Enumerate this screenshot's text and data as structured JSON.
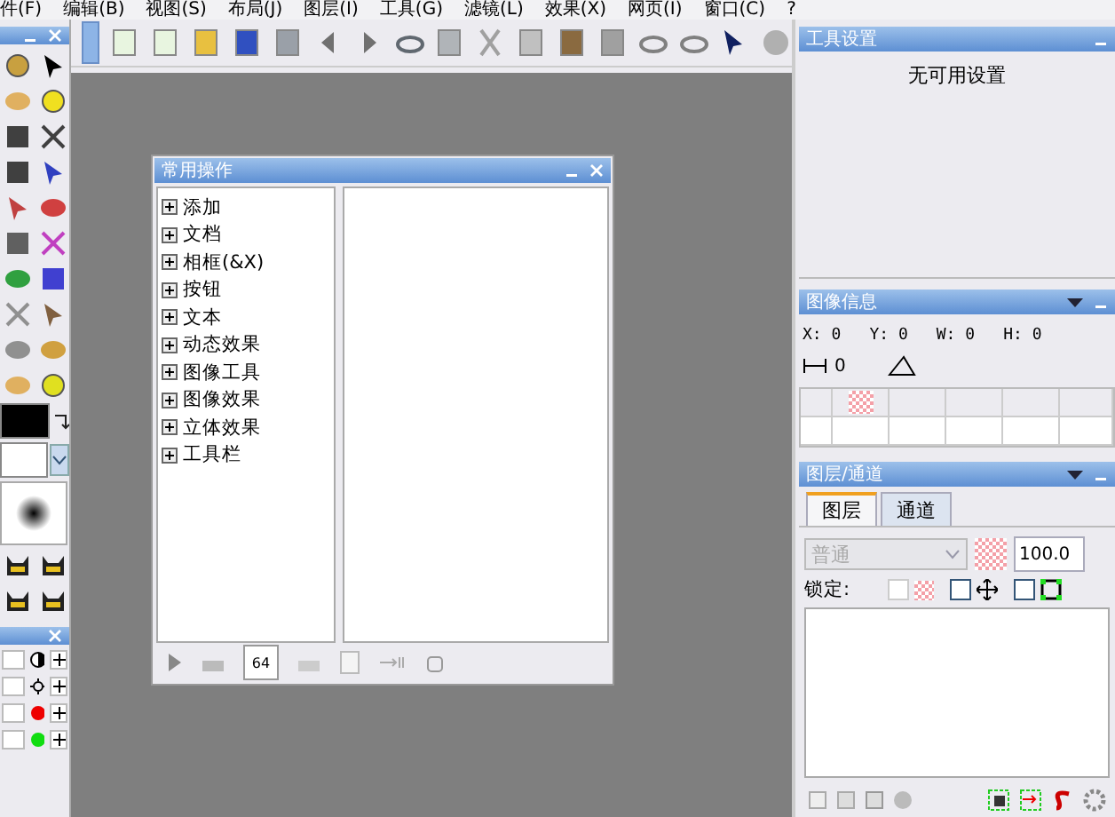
{
  "menu_bar": [
    {
      "label": "件(F)"
    },
    {
      "label": "编辑(B)"
    },
    {
      "label": "视图(S)"
    },
    {
      "label": "布局(J)"
    },
    {
      "label": "图层(I)"
    },
    {
      "label": "工具(G)"
    },
    {
      "label": "滤镜(L)"
    },
    {
      "label": "效果(X)"
    },
    {
      "label": "网页(I)"
    },
    {
      "label": "窗口(C)"
    },
    {
      "label": "?"
    }
  ],
  "tool_settings": {
    "title": "工具设置",
    "message": "无可用设置"
  },
  "image_info": {
    "title": "图像信息",
    "fields": [
      {
        "label": "X:",
        "value": "0"
      },
      {
        "label": "Y:",
        "value": "0"
      },
      {
        "label": "W:",
        "value": "0"
      },
      {
        "label": "H:",
        "value": "0"
      }
    ],
    "distance": "0"
  },
  "layers": {
    "title": "图层/通道",
    "tabs": [
      {
        "label": "图层",
        "selected": true
      },
      {
        "label": "通道",
        "selected": false
      }
    ],
    "blend_mode": {
      "value": "普通",
      "disabled": true
    },
    "opacity": "100.0",
    "lock_label": "锁定:",
    "locks": [
      {
        "checked": false
      },
      {
        "checked": false
      },
      {
        "checked": false
      }
    ]
  },
  "mini_panel": {
    "rows": [
      {
        "kind": "contrast"
      },
      {
        "kind": "brightness"
      },
      {
        "kind": "dot",
        "color": "#ee0000"
      },
      {
        "kind": "dot",
        "color": "#11dd11"
      }
    ]
  },
  "dialog": {
    "title": "常用操作",
    "tree": [
      {
        "label": "添加",
        "expanded": false
      },
      {
        "label": "文档",
        "expanded": false
      },
      {
        "label": "相框(&X)",
        "expanded": false
      },
      {
        "label": "按钮",
        "expanded": false
      },
      {
        "label": "文本",
        "expanded": false
      },
      {
        "label": "动态效果",
        "expanded": false
      },
      {
        "label": "图像工具",
        "expanded": false
      },
      {
        "label": "图像效果",
        "expanded": false
      },
      {
        "label": "立体效果",
        "expanded": false
      },
      {
        "label": "工具栏",
        "expanded": false
      }
    ],
    "size_button": "64"
  }
}
